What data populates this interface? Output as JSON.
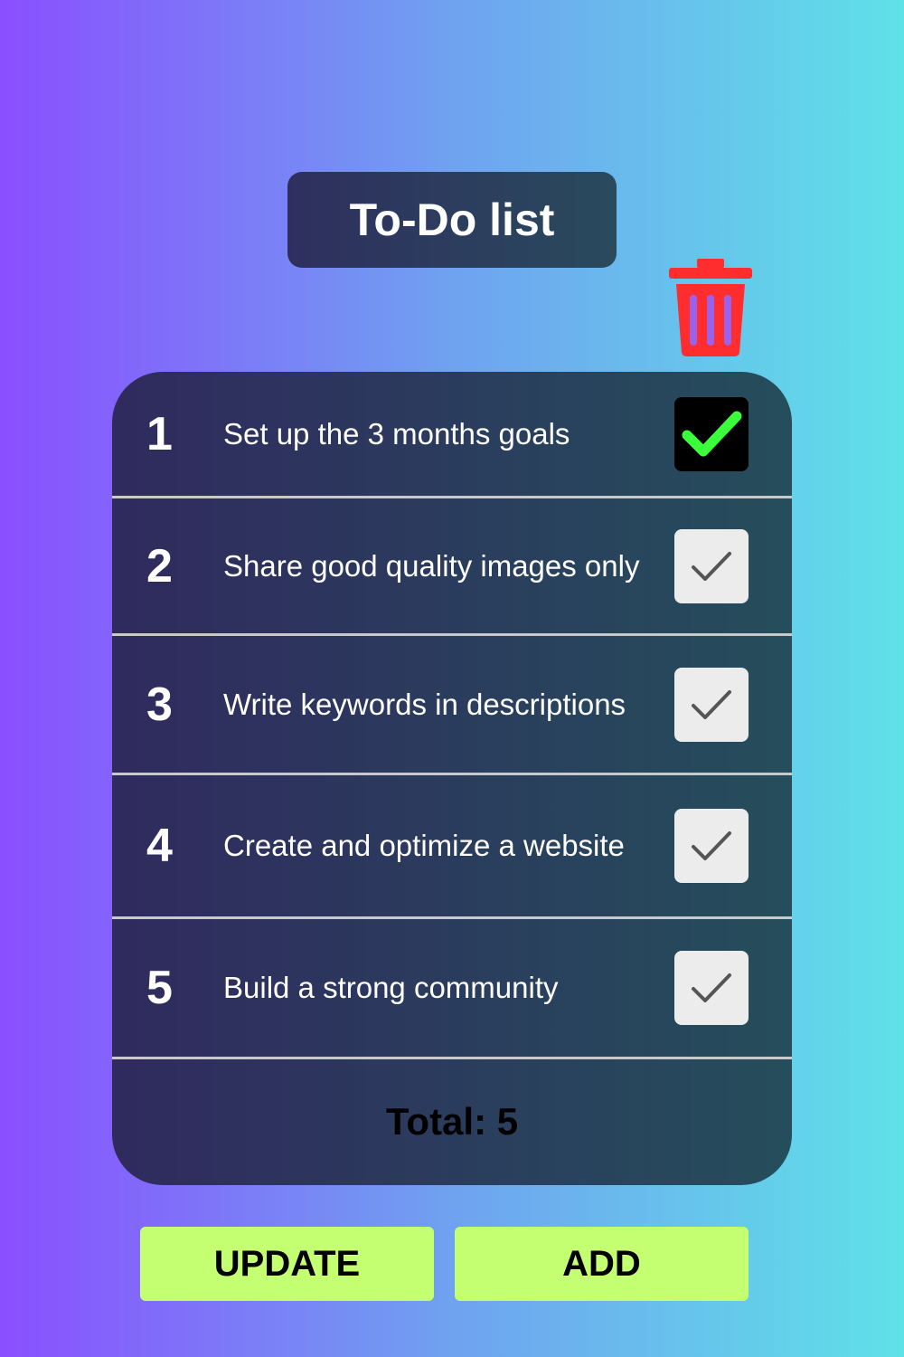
{
  "header": {
    "title": "To-Do list"
  },
  "tasks": [
    {
      "number": "1",
      "text": "Set up the 3 months goals",
      "done": true
    },
    {
      "number": "2",
      "text": "Share good quality images only",
      "done": false
    },
    {
      "number": "3",
      "text": "Write keywords in descriptions",
      "done": false
    },
    {
      "number": "4",
      "text": "Create and optimize a website",
      "done": false
    },
    {
      "number": "5",
      "text": "Build a strong community",
      "done": false
    }
  ],
  "footer": {
    "total": "Total: 5"
  },
  "actions": {
    "update_label": "UPDATE",
    "add_label": "ADD"
  },
  "icons": {
    "delete": "trash-icon",
    "check": "checkmark-icon"
  },
  "colors": {
    "accent_button": "#c4ff72",
    "done_check": "#3cff3c",
    "trash": "#ff2d2d"
  }
}
